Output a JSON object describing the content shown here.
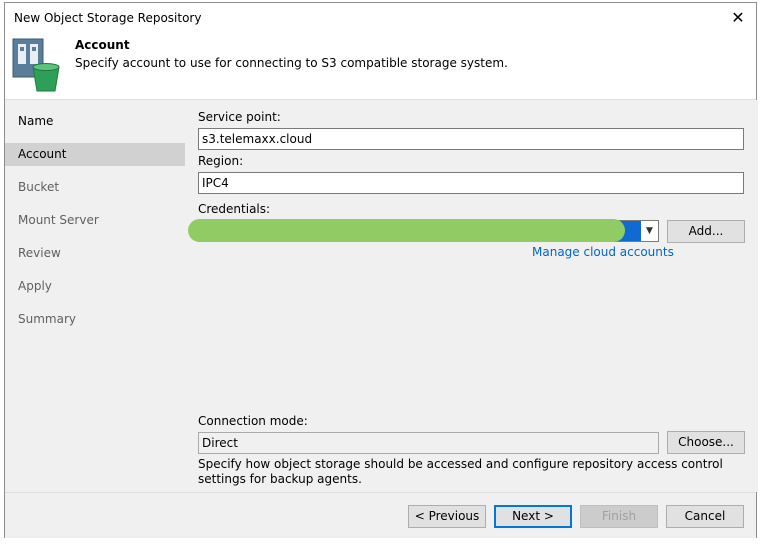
{
  "window": {
    "title": "New Object Storage Repository",
    "close_glyph": "✕"
  },
  "header": {
    "title": "Account",
    "description": "Specify account to use for connecting to S3 compatible storage system."
  },
  "steps": [
    {
      "label": "Name"
    },
    {
      "label": "Account"
    },
    {
      "label": "Bucket"
    },
    {
      "label": "Mount Server"
    },
    {
      "label": "Review"
    },
    {
      "label": "Apply"
    },
    {
      "label": "Summary"
    }
  ],
  "form": {
    "service_point": {
      "label": "Service point:",
      "value": "s3.telemaxx.cloud"
    },
    "region": {
      "label": "Region:",
      "value": "IPC4"
    },
    "credentials": {
      "label": "Credentials:",
      "add_button": "Add...",
      "manage_link": "Manage cloud accounts"
    },
    "connection_mode": {
      "label": "Connection mode:",
      "value": "Direct",
      "choose_button": "Choose...",
      "help": "Specify how object storage should be accessed and configure repository access control settings for backup agents."
    }
  },
  "footer": {
    "previous": "< Previous",
    "next": "Next >",
    "finish": "Finish",
    "cancel": "Cancel"
  },
  "colors": {
    "selection": "#0f6bd0",
    "redaction": "#90cc63",
    "link": "#0066cc"
  }
}
